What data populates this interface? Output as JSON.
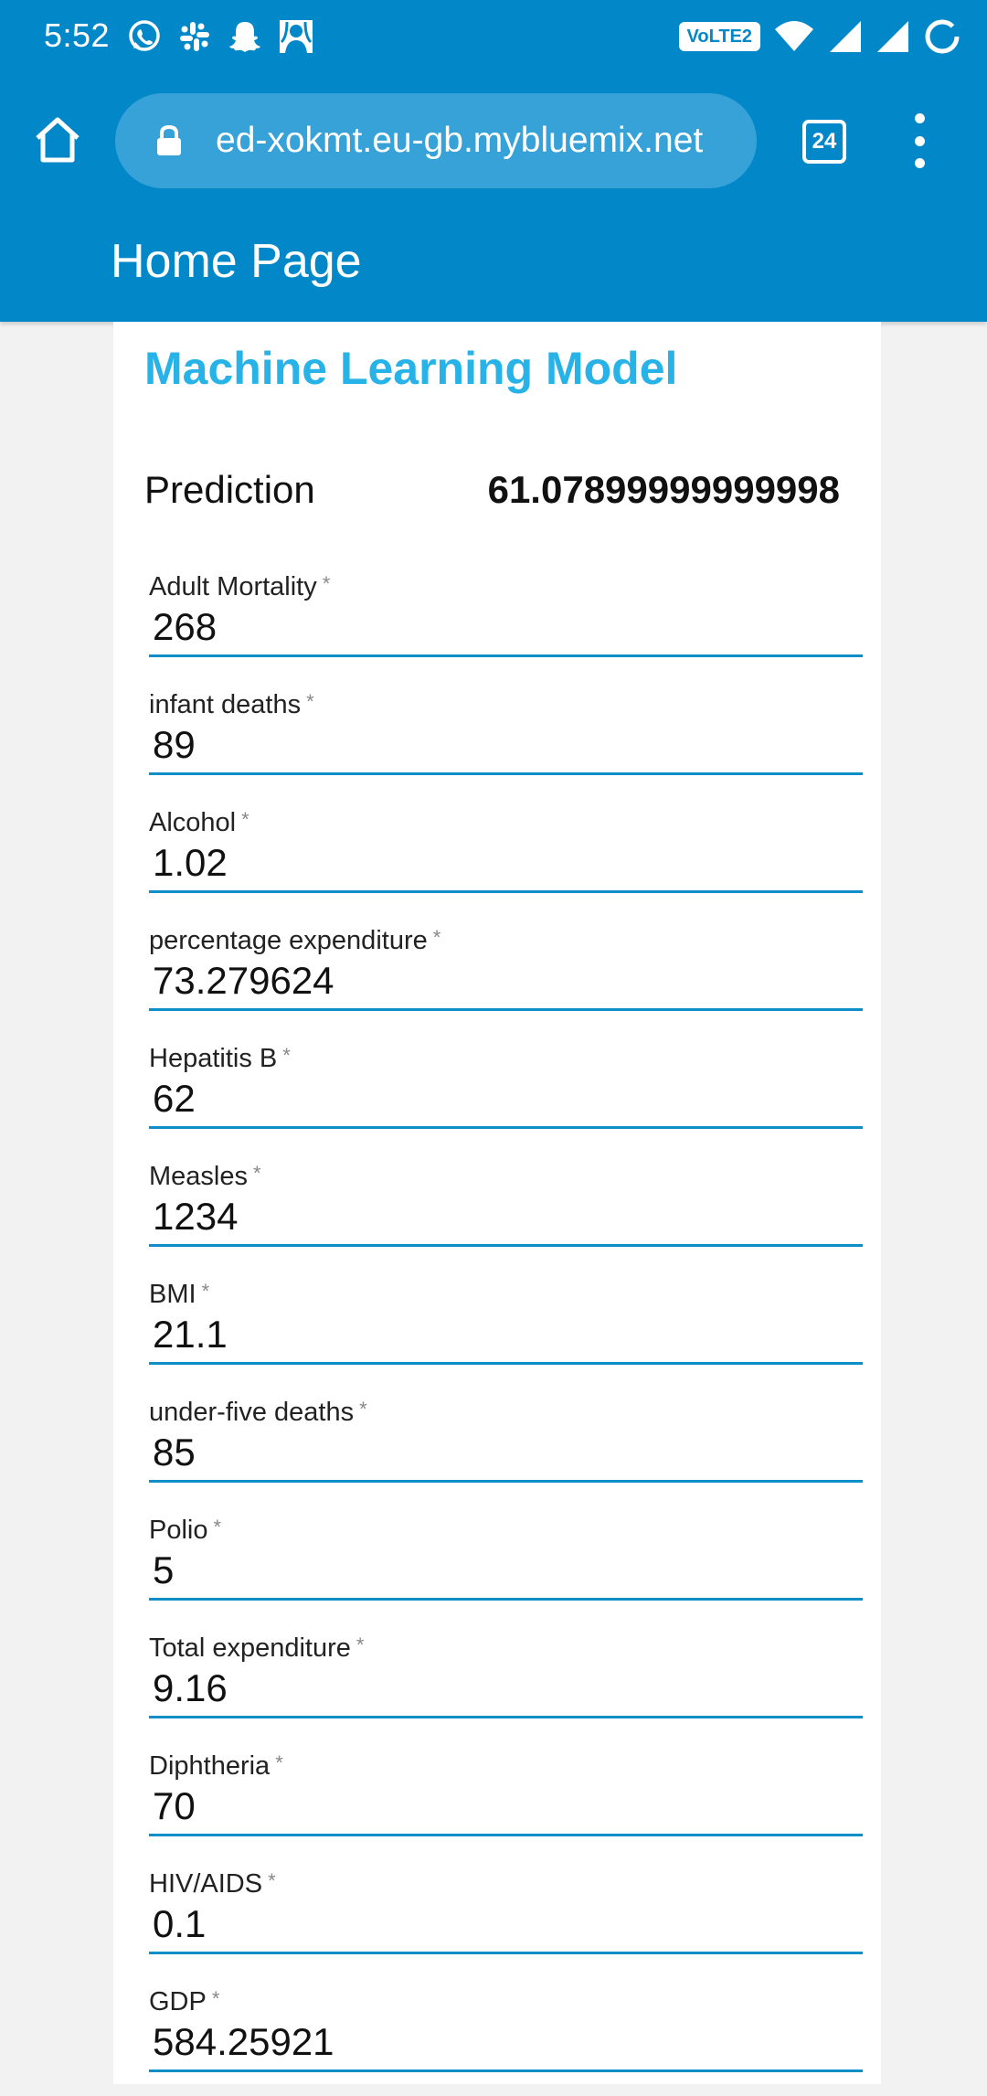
{
  "status_bar": {
    "time": "5:52",
    "network_label": "VoLTE2",
    "left_icons": [
      "whatsapp-icon",
      "slack-icon",
      "snapchat-icon",
      "avatar-notification-icon"
    ],
    "right_icons": [
      "wifi-icon",
      "signal-1-icon",
      "signal-2-icon",
      "battery-saver-icon"
    ]
  },
  "browser": {
    "url": "ed-xokmt.eu-gb.mybluemix.net",
    "tab_count": "24"
  },
  "header": {
    "title": "Home Page"
  },
  "card": {
    "title": "Machine Learning Model",
    "prediction_label": "Prediction",
    "prediction_value": "61.07899999999998",
    "required_marker": "*",
    "fields": [
      {
        "label": "Adult Mortality",
        "value": "268"
      },
      {
        "label": "infant deaths",
        "value": "89"
      },
      {
        "label": "Alcohol",
        "value": "1.02"
      },
      {
        "label": "percentage expenditure",
        "value": "73.279624"
      },
      {
        "label": "Hepatitis B",
        "value": "62"
      },
      {
        "label": "Measles",
        "value": "1234"
      },
      {
        "label": "BMI",
        "value": "21.1"
      },
      {
        "label": "under-five deaths",
        "value": "85"
      },
      {
        "label": "Polio",
        "value": "5"
      },
      {
        "label": "Total expenditure",
        "value": "9.16"
      },
      {
        "label": "Diphtheria",
        "value": "70"
      },
      {
        "label": "HIV/AIDS",
        "value": "0.1"
      },
      {
        "label": "GDP",
        "value": "584.25921"
      }
    ]
  },
  "colors": {
    "primary": "#0288c9",
    "url_pill": "#36a2d8",
    "card_title": "#28b3e8",
    "input_underline": "#0f8fc9"
  }
}
